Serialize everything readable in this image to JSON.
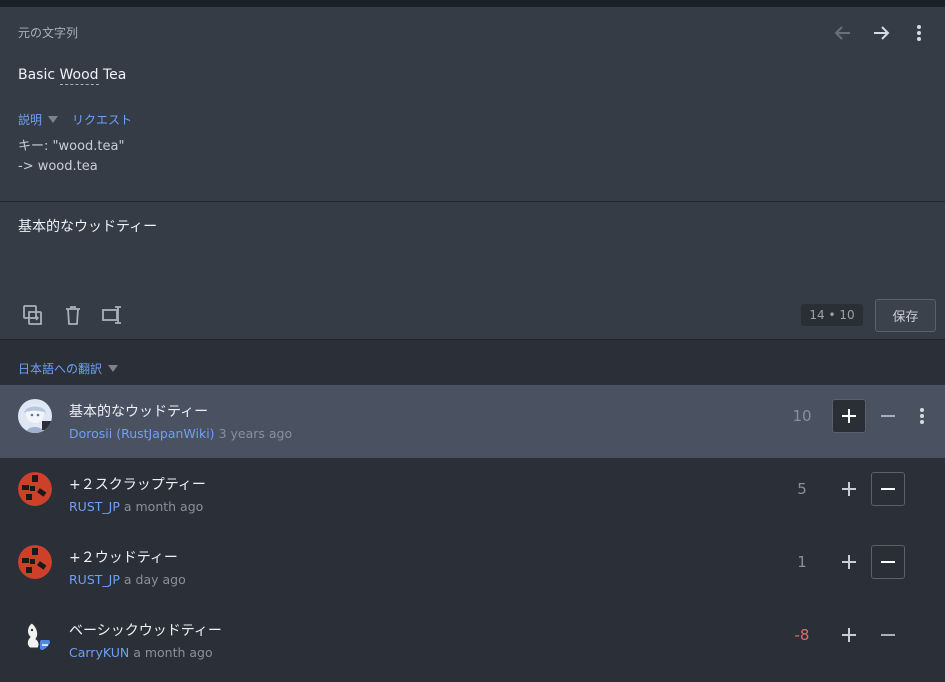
{
  "source": {
    "label": "元の文字列",
    "text_prefix": "Basic ",
    "text_term": "Wood",
    "text_suffix": " Tea",
    "context_tabs": [
      {
        "label": "説明"
      },
      {
        "label": "リクエスト"
      }
    ],
    "context_lines": [
      "キー: \"wood.tea\"",
      "-> wood.tea"
    ]
  },
  "editor": {
    "value": "基本的なウッドティー",
    "counter": "14 • 10",
    "save_label": "保存"
  },
  "translations_header": "日本語への翻訳",
  "translations": [
    {
      "text": "基本的なウッドティー",
      "user": "Dorosii (RustJapanWiki)",
      "time": "3 years ago",
      "score": "10"
    },
    {
      "text": "+２スクラップティー",
      "user": "RUST_JP",
      "time": "a month ago",
      "score": "5"
    },
    {
      "text": "+２ウッドティー",
      "user": "RUST_JP",
      "time": "a day ago",
      "score": "1"
    },
    {
      "text": "ベーシックウッドティー",
      "user": "CarryKUN",
      "time": "a month ago",
      "score": "-8"
    }
  ],
  "colors": {
    "accent": "#6ea0f5",
    "negative": "#e36a6a",
    "panel": "#363c46",
    "selected_row": "#4a5160"
  }
}
